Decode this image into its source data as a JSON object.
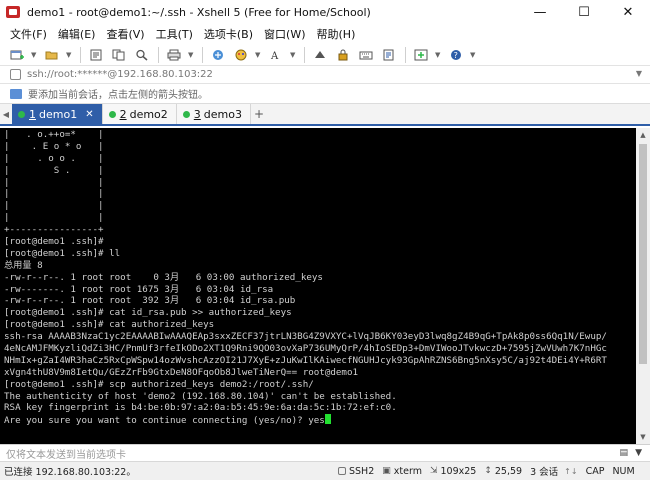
{
  "window": {
    "title": "demo1 - root@demo1:~/.ssh - Xshell 5 (Free for Home/School)",
    "minimize": "—",
    "maximize": "☐",
    "close": "✕"
  },
  "menu": {
    "items": [
      "文件(F)",
      "编辑(E)",
      "查看(V)",
      "工具(T)",
      "选项卡(B)",
      "窗口(W)",
      "帮助(H)"
    ]
  },
  "toolbar": {
    "icons": [
      "new-session-icon",
      "open-folder-icon",
      "properties-icon",
      "copy-icon",
      "search-icon",
      "print-icon",
      "transfer-icon",
      "color-icon",
      "font-icon",
      "lock-icon",
      "keyboard-icon",
      "script-icon",
      "add-icon",
      "help-icon"
    ]
  },
  "address": {
    "value": "ssh://root:******@192.168.80.103:22"
  },
  "hint": {
    "text": "要添加当前会话，点击左侧的箭头按钮。"
  },
  "tabs": [
    {
      "num": "1",
      "label": "demo1",
      "active": true
    },
    {
      "num": "2",
      "label": "demo2",
      "active": false
    },
    {
      "num": "3",
      "label": "demo3",
      "active": false
    }
  ],
  "terminal": {
    "lines": [
      "|   . o.++o=*    |",
      "|    . E o * o   |",
      "|     . o o .    |",
      "|        S .     |",
      "|                |",
      "|                |",
      "|                |",
      "|                |",
      "+----------------+",
      "[root@demo1 .ssh]#",
      "[root@demo1 .ssh]# ll",
      "总用量 8",
      "-rw-r--r--. 1 root root    0 3月   6 03:00 authorized_keys",
      "-rw-------. 1 root root 1675 3月   6 03:04 id_rsa",
      "-rw-r--r--. 1 root root  392 3月   6 03:04 id_rsa.pub",
      "[root@demo1 .ssh]# cat id_rsa.pub >> authorized_keys",
      "[root@demo1 .ssh]# cat authorized_keys",
      "ssh-rsa AAAAB3NzaC1yc2EAAAABIwAAAQEAp3sxxZECF37jtrLN3BG4Z9VXYC+lVqJB6KY03eyD3lwq8gZ4B9qG+TpAk8p0ss6Qq1N/Ewup/",
      "4eNcAMJFMKyzliQdZi3HC/PnmUf3rfeIkODo2XT1Q9Rni9QO03ovXaP736UMyQrP/4hIoSEDp3+DmVIWooJTvkwczD+7595jZwVUwh7K7nHGc",
      "NHmIx+gZaI4WR3haCz5RxCpWSpw14ozWvshcAzzOI21J7XyE+zJuKwIlKAiwecfNGUHJcyk93GpAhRZNS6Bng5nXsy5C/aj92t4DEi4Y+R6RT",
      "xVgn4thU8V9m8IetQu/GEzZrFb9GtxDeN8OFqoOb8JlweTiNerQ== root@demo1",
      "[root@demo1 .ssh]# scp authorized_keys demo2:/root/.ssh/",
      "The authenticity of host 'demo2 (192.168.80.104)' can't be established.",
      "RSA key fingerprint is b4:be:0b:97:a2:0a:b5:45:9e:6a:da:5c:1b:72:ef:c0.",
      "Are you sure you want to continue connecting (yes/no)? yes"
    ]
  },
  "sendbar": {
    "placeholder": "仅将文本发送到当前选项卡",
    "button": "▤"
  },
  "status": {
    "connection": "已连接 192.168.80.103:22。",
    "protocol": "SSH2",
    "terminal_type": "xterm",
    "size": "109x25",
    "cursor_pos": "25,59",
    "sessions": "3 会话",
    "caps": "CAP",
    "num": "NUM"
  },
  "colors": {
    "accent": "#2f5ea8",
    "terminal_bg": "#000000",
    "terminal_fg": "#d0d0d0",
    "cursor": "#22e030",
    "tab_dot": "#2fb84a"
  }
}
